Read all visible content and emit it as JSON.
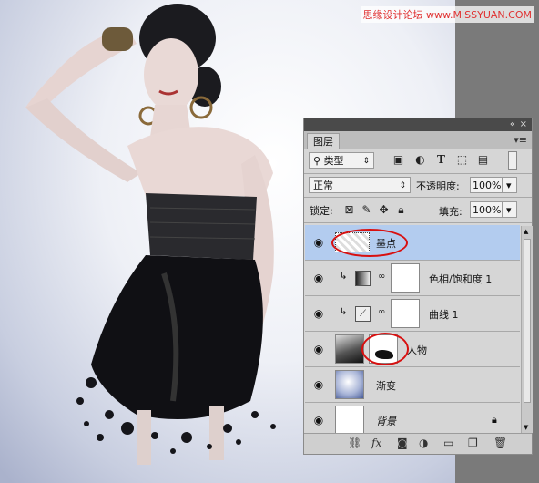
{
  "watermark": "思缘设计论坛 www.MISSYUAN.COM",
  "panel": {
    "tab_label": "图层",
    "collapse_icon": "double-chevron-left-icon",
    "close_icon": "close-icon",
    "menu_icon": "panel-menu-icon",
    "filter": {
      "search_icon": "search-icon",
      "kind_value": "类型"
    },
    "blend_mode": "正常",
    "opacity_label": "不透明度:",
    "opacity_value": "100%",
    "lock_label": "锁定:",
    "fill_label": "填充:",
    "fill_value": "100%",
    "layers": [
      {
        "name": "墨点",
        "selected": true
      },
      {
        "name": "色相/饱和度 1",
        "selected": false
      },
      {
        "name": "曲线 1",
        "selected": false
      },
      {
        "name": "人物",
        "selected": false
      },
      {
        "name": "渐变",
        "selected": false
      },
      {
        "name": "背景",
        "selected": false
      }
    ],
    "bottom_icons": [
      "link-icon",
      "fx-icon",
      "mask-icon",
      "adjustment-icon",
      "folder-icon",
      "new-layer-icon",
      "trash-icon"
    ],
    "fx_label": "fx"
  },
  "colors": {
    "selection": "#b3ccef",
    "annotation_ring": "#d81010",
    "panel_bg": "#d6d6d6"
  }
}
